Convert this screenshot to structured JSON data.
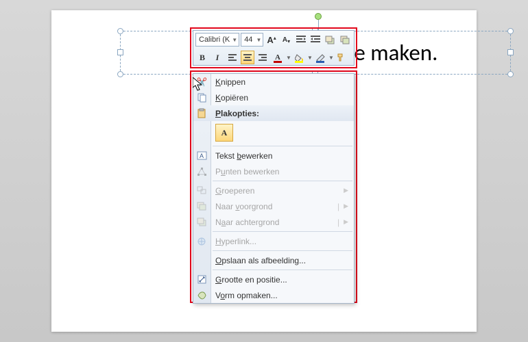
{
  "textbox": {
    "placeholder_text": "Klik om een titel te maken."
  },
  "mini_toolbar": {
    "font_name": "Calibri (K",
    "font_size": "44",
    "increase_font": "A",
    "decrease_font": "A",
    "bold": "B",
    "italic": "I",
    "font_color_swatch": "#c00000",
    "highlight_swatch": "#ffff00",
    "underline_swatch": "#2a5db0"
  },
  "context_menu": {
    "cut": "Knippen",
    "copy": "Kopiëren",
    "paste_header": "Plakopties:",
    "paste_keep": "A",
    "edit_text": "Tekst bewerken",
    "edit_points": "Punten bewerken",
    "group": "Groeperen",
    "bring_front": "Naar voorgrond",
    "send_back": "Naar achtergrond",
    "hyperlink": "Hyperlink...",
    "save_as_picture": "Opslaan als afbeelding...",
    "size_position": "Grootte en positie...",
    "format_shape": "Vorm opmaken..."
  },
  "accelerators": {
    "cut": "K",
    "copy": "K",
    "paste": "P",
    "edit_text": "b",
    "edit_points": "u",
    "group": "G",
    "front": "v",
    "back": "a",
    "hyperlink": "H",
    "save": "O",
    "size": "G",
    "format": "o"
  }
}
